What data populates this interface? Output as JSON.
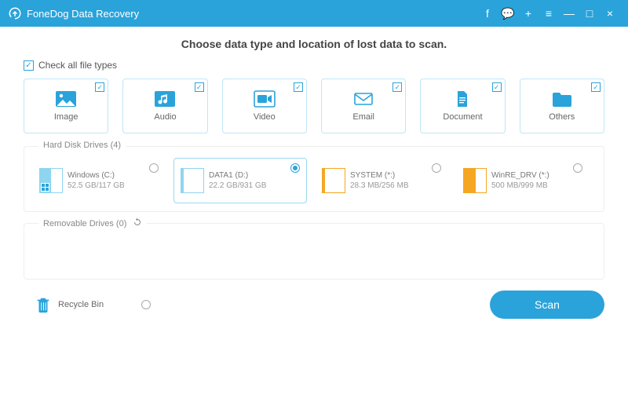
{
  "titlebar": {
    "app_name": "FoneDog Data Recovery",
    "buttons": {
      "facebook": "f",
      "feedback": "💬",
      "add": "+",
      "menu": "≡",
      "min": "—",
      "max": "□",
      "close": "×"
    }
  },
  "heading": "Choose data type and location of lost data to scan.",
  "check_all_label": "Check all file types",
  "check_all_checked": true,
  "types": [
    {
      "key": "image",
      "label": "Image",
      "checked": true
    },
    {
      "key": "audio",
      "label": "Audio",
      "checked": true
    },
    {
      "key": "video",
      "label": "Video",
      "checked": true
    },
    {
      "key": "email",
      "label": "Email",
      "checked": true
    },
    {
      "key": "document",
      "label": "Document",
      "checked": true
    },
    {
      "key": "others",
      "label": "Others",
      "checked": true
    }
  ],
  "hard_drives": {
    "legend": "Hard Disk Drives (4)",
    "items": [
      {
        "name": "Windows (C:)",
        "size": "52.5 GB/117 GB",
        "selected": false,
        "color": "#8fd5f0",
        "fill": 0.45,
        "os": true
      },
      {
        "name": "DATA1 (D:)",
        "size": "22.2 GB/931 GB",
        "selected": true,
        "color": "#8fd5f0",
        "fill": 0.03,
        "os": false
      },
      {
        "name": "SYSTEM (*:)",
        "size": "28.3 MB/256 MB",
        "selected": false,
        "color": "#f5a623",
        "fill": 0.11,
        "os": false
      },
      {
        "name": "WinRE_DRV (*:)",
        "size": "500 MB/999 MB",
        "selected": false,
        "color": "#f5a623",
        "fill": 0.5,
        "os": false
      }
    ]
  },
  "removable": {
    "legend": "Removable Drives (0)"
  },
  "recycle_label": "Recycle Bin",
  "scan_label": "Scan"
}
